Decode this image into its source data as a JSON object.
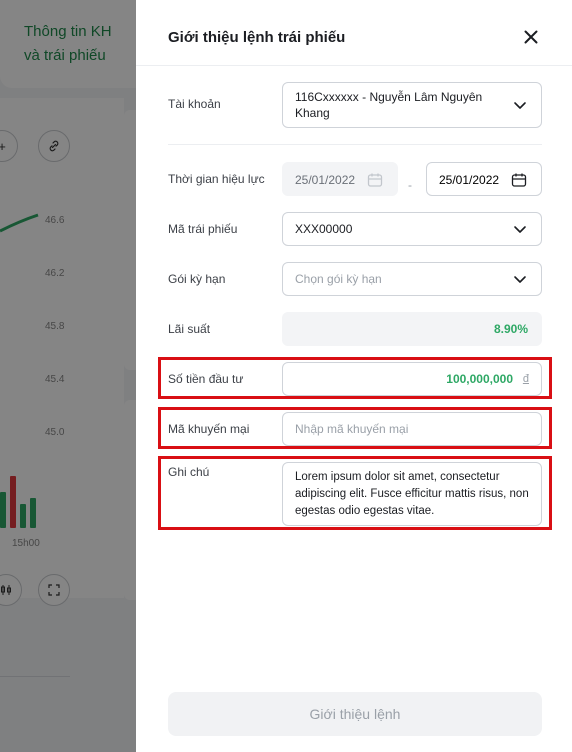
{
  "background": {
    "tab_label": "Thông tin KH\nvà trái phiếu",
    "axis_ticks": [
      "46.6",
      "46.2",
      "45.8",
      "45.4",
      "45.0"
    ],
    "time_label": "15h00"
  },
  "modal": {
    "title": "Giới thiệu lệnh trái phiếu",
    "close_icon": "close-icon"
  },
  "form": {
    "account": {
      "label": "Tài khoản",
      "value": "116Cxxxxxx - Nguyễn Lâm Nguyên Khang"
    },
    "validity": {
      "label": "Thời gian hiệu lực",
      "from": "25/01/2022",
      "separator": "-",
      "to": "25/01/2022"
    },
    "bond_code": {
      "label": "Mã trái phiếu",
      "value": "XXX00000"
    },
    "term_package": {
      "label": "Gói kỳ hạn",
      "placeholder": "Chọn gói kỳ hạn"
    },
    "interest_rate": {
      "label": "Lãi suất",
      "value": "8.90%"
    },
    "investment_amount": {
      "label": "Số tiền đầu tư",
      "value": "100,000,000",
      "unit": "đ"
    },
    "promo_code": {
      "label": "Mã khuyến mại",
      "placeholder": "Nhập mã khuyến mại"
    },
    "note": {
      "label": "Ghi chú",
      "value": "Lorem ipsum dolor sit amet, consectetur adipiscing elit. Fusce efficitur mattis risus, non egestas odio egestas vitae."
    }
  },
  "submit_label": "Giới thiệu lệnh",
  "colors": {
    "accent_green": "#2ea865",
    "highlight_red": "#d90f14"
  }
}
